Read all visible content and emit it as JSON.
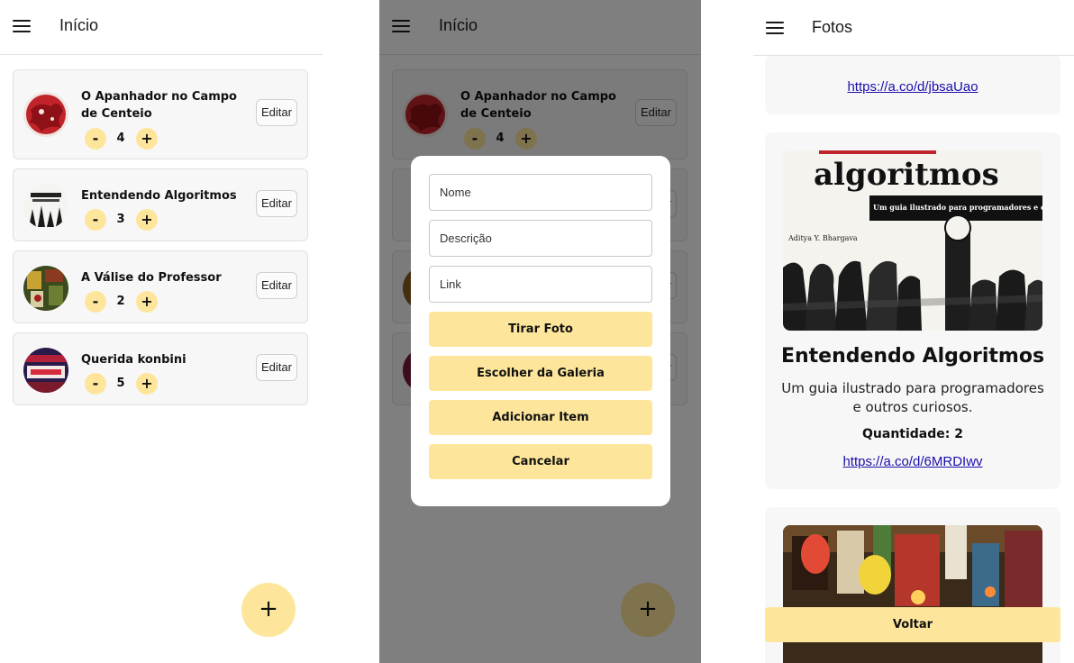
{
  "inicio": {
    "title": "Início",
    "edit_label": "Editar",
    "minus_label": "-",
    "plus_label": "+",
    "fab_label": "+",
    "items": [
      {
        "name": "O Apanhador no Campo de Centeio",
        "qty": "4",
        "thumb_color": "#c0242a"
      },
      {
        "name": "Entendendo Algoritmos",
        "qty": "3",
        "thumb_color": "#2b2b2b"
      },
      {
        "name": "A Válise do Professor",
        "qty": "2",
        "thumb_color": "#5a6b2a"
      },
      {
        "name": "Querida konbini",
        "qty": "5",
        "thumb_color": "#b3203a"
      }
    ]
  },
  "modal": {
    "nome_placeholder": "Nome",
    "descricao_placeholder": "Descrição",
    "link_placeholder": "Link",
    "tirar_foto": "Tirar Foto",
    "escolher_galeria": "Escolher da Galeria",
    "adicionar_item": "Adicionar Item",
    "cancelar": "Cancelar"
  },
  "fotos": {
    "title": "Fotos",
    "first_link": "https://a.co/d/jbsaUao",
    "cover_title": "algoritmos",
    "cover_subtitle": "Um guia ilustrado para programadores e outros curiosos",
    "cover_author": "Aditya Y. Bhargava",
    "item": {
      "name": "Entendendo Algoritmos",
      "description": "Um guia ilustrado para programadores e outros curiosos.",
      "quantity": "Quantidade: 2",
      "link": "https://a.co/d/6MRDIwv"
    },
    "back_label": "Voltar"
  },
  "colors": {
    "accent": "#fde69b",
    "card_bg": "#f7f7f7",
    "link": "#1a0dab"
  }
}
